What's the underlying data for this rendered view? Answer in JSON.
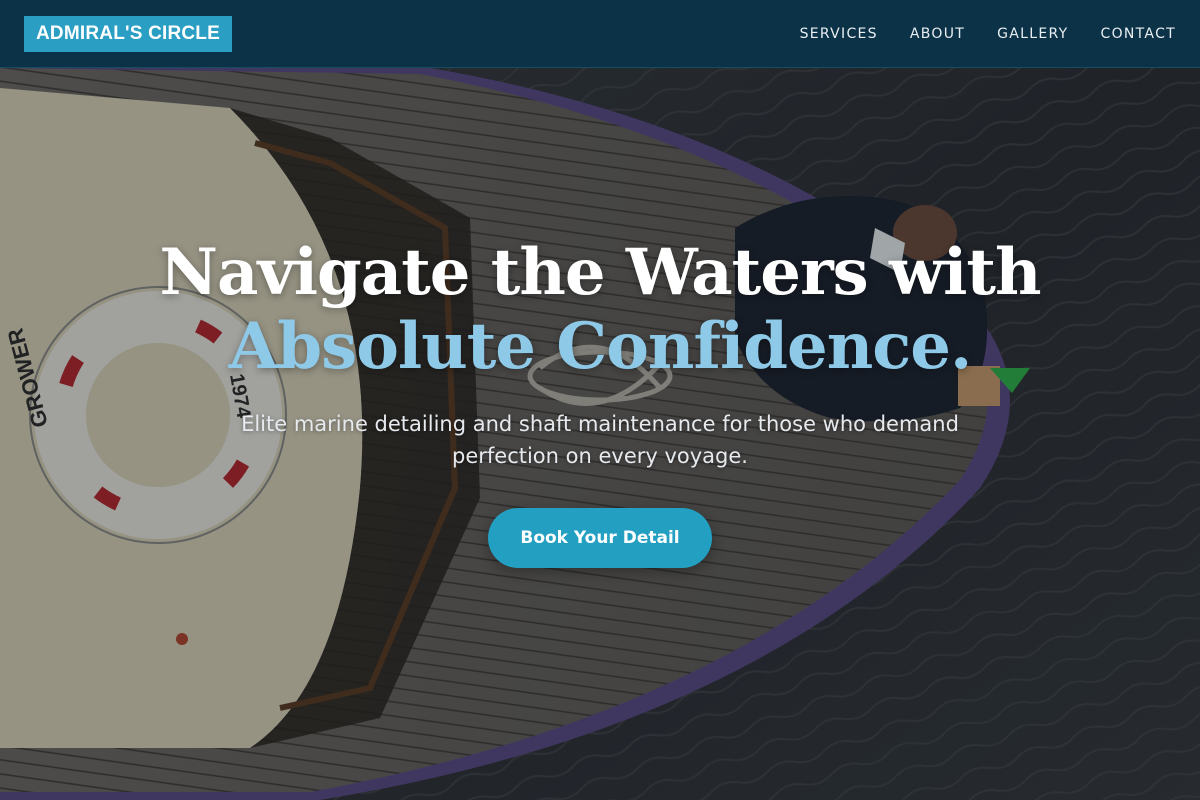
{
  "nav": {
    "brand": "ADMIRAL'S CIRCLE",
    "links": [
      {
        "label": "SERVICES"
      },
      {
        "label": "ABOUT"
      },
      {
        "label": "GALLERY"
      },
      {
        "label": "CONTACT"
      }
    ]
  },
  "hero": {
    "headline_line1": "Navigate the Waters with",
    "headline_line2": "Absolute Confidence.",
    "subheadline": "Elite marine detailing and shaft maintenance for those who demand perfection on every voyage.",
    "cta_label": "Book Your Detail",
    "background_image": "aerial-boat-deck-with-life-ring-and-worker",
    "lifebuoy_text": "GROWER",
    "lifebuoy_number": "1974"
  },
  "colors": {
    "nav_background": "#0c3247",
    "brand_background": "#2a9ec3",
    "accent_text": "#8ec9e8",
    "cta_background": "#239fc2"
  }
}
